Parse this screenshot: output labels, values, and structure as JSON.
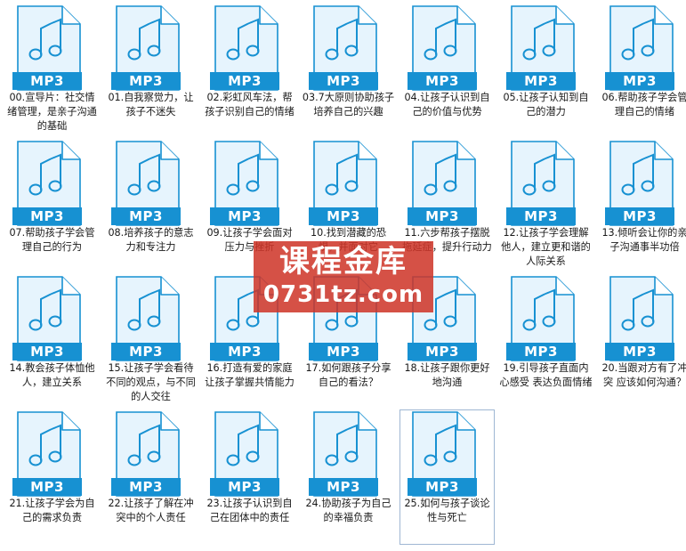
{
  "file_icon": {
    "badge_label": "MP3",
    "icon_name": "music-note-icon",
    "accent_color": "#1791d2",
    "page_color": "#e6f4fd"
  },
  "files": [
    {
      "name": "00.宣导片：社交情绪管理，是亲子沟通的基础"
    },
    {
      "name": "01.自我察觉力，让孩子不迷失"
    },
    {
      "name": "02.彩虹风车法，帮孩子识别自己的情绪"
    },
    {
      "name": "03.7大原则协助孩子培养自己的兴趣"
    },
    {
      "name": "04.让孩子认识到自己的价值与优势"
    },
    {
      "name": "05.让孩子认知到自己的潜力"
    },
    {
      "name": "06.帮助孩子学会管理自己的情绪"
    },
    {
      "name": "07.帮助孩子学会管理自己的行为"
    },
    {
      "name": "08.培养孩子的意志力和专注力"
    },
    {
      "name": "09.让孩子学会面对压力与挫折"
    },
    {
      "name": "10.找到潜藏的恐惧，并面对它"
    },
    {
      "name": "11.六步帮孩子摆脱拖延症，提升行动力"
    },
    {
      "name": "12.让孩子学会理解他人，建立更和谐的人际关系"
    },
    {
      "name": "13.倾听会让你的亲子沟通事半功倍"
    },
    {
      "name": "14.教会孩子体恤他人，建立关系"
    },
    {
      "name": "15.让孩子学会看待不同的观点，与不同的人交往"
    },
    {
      "name": "16.打造有爱的家庭 让孩子掌握共情能力"
    },
    {
      "name": "17.如何跟孩子分享自己的看法？"
    },
    {
      "name": "18.让孩子跟你更好地沟通"
    },
    {
      "name": "19.引导孩子直面内心感受 表达负面情绪"
    },
    {
      "name": "20.当跟对方有了冲突 应该如何沟通？"
    },
    {
      "name": "21.让孩子学会为自己的需求负责"
    },
    {
      "name": "22.让孩子了解在冲突中的个人责任"
    },
    {
      "name": "23.让孩子认识到自己在团体中的责任"
    },
    {
      "name": "24.协助孩子为自己的幸福负责"
    },
    {
      "name": "25.如何与孩子谈论性与死亡",
      "selected": true
    }
  ],
  "watermark": {
    "line1": "课程金库",
    "line2": "0731tz.com",
    "color": "#ce3428"
  }
}
